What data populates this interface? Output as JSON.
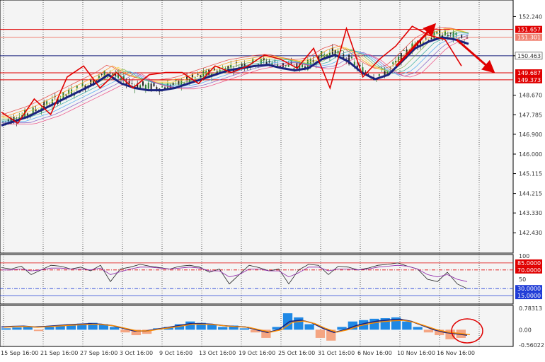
{
  "chart_data": [
    {
      "type": "line",
      "panel": "price",
      "ylim": [
        141.7,
        152.8
      ],
      "y_ticks": [
        "152.240",
        "150.463",
        "148.670",
        "147.785",
        "146.900",
        "146.000",
        "145.115",
        "144.215",
        "143.330",
        "142.430"
      ],
      "horizontal_levels": [
        {
          "label": "151.657",
          "value": 151.657,
          "color": "#e00000",
          "style": "solid",
          "box": true
        },
        {
          "label": "151.301",
          "value": 151.301,
          "color": "#f08070",
          "style": "solid",
          "box": true
        },
        {
          "label": "150.463",
          "value": 150.463,
          "color": "#1a237e",
          "style": "solid",
          "box": false
        },
        {
          "label": "149.687",
          "value": 149.687,
          "color": "#e00000",
          "style": "solid",
          "box": true
        },
        {
          "label": "149.373",
          "value": 149.373,
          "color": "#e00000",
          "style": "solid",
          "box": true
        }
      ],
      "moving_average": [
        147.3,
        147.5,
        147.7,
        148.0,
        148.3,
        148.6,
        148.9,
        149.2,
        149.6,
        149.2,
        149.0,
        148.9,
        148.9,
        149.0,
        149.2,
        149.4,
        149.6,
        149.8,
        149.9,
        150.0,
        150.05,
        149.9,
        149.8,
        149.9,
        150.3,
        150.5,
        150.2,
        149.7,
        149.4,
        149.6,
        150.2,
        150.8,
        151.1,
        151.3,
        151.2,
        151.0
      ],
      "zigzag": [
        147.9,
        147.4,
        148.5,
        147.8,
        149.5,
        150.0,
        149.0,
        149.7,
        149.0,
        149.6,
        149.7,
        149.7,
        149.2,
        150.0,
        149.7,
        150.0,
        150.5,
        150.3,
        149.9,
        150.8,
        149.0,
        151.7,
        149.5,
        150.3,
        150.9,
        151.8,
        151.4,
        151.2,
        150.0
      ],
      "forecast_arrows": [
        {
          "from": 150.0,
          "to": 151.8,
          "direction": "up"
        },
        {
          "from": 151.2,
          "to": 149.8,
          "direction": "down"
        }
      ],
      "x_labels": [
        "15 Sep 16:00",
        "21 Sep 16:00",
        "27 Sep 16:00",
        "3 Oct 16:00",
        "9 Oct 16:00",
        "13 Oct 16:00",
        "19 Oct 16:00",
        "25 Oct 16:00",
        "31 Oct 16:00",
        "6 Nov 16:00",
        "10 Nov 16:00",
        "16 Nov 16:00"
      ]
    },
    {
      "type": "line",
      "panel": "oscillator",
      "ylim": [
        0,
        100
      ],
      "y_ticks": [
        "100",
        "50"
      ],
      "levels": [
        {
          "label": "85.0000",
          "value": 85,
          "color": "#e00000",
          "box": true
        },
        {
          "label": "70.0000",
          "value": 70,
          "color": "#e00000",
          "box": true
        },
        {
          "label": "30.0000",
          "value": 30,
          "color": "#1f3bd6",
          "box": true
        },
        {
          "label": "15.0000",
          "value": 15,
          "color": "#1f3bd6",
          "box": true
        }
      ],
      "series": [
        {
          "values": [
            75,
            72,
            78,
            60,
            70,
            80,
            78,
            72,
            76,
            68,
            80,
            45,
            72,
            76,
            82,
            78,
            75,
            72,
            78,
            80,
            76,
            65,
            72,
            40,
            60,
            80,
            75,
            68,
            72,
            40,
            70,
            82,
            80,
            60,
            78,
            76,
            70,
            74,
            80,
            82,
            85,
            78,
            72,
            50,
            45,
            65,
            40,
            30
          ]
        },
        {
          "values": [
            70,
            70,
            72,
            68,
            70,
            74,
            74,
            72,
            72,
            70,
            74,
            60,
            66,
            72,
            76,
            76,
            74,
            72,
            74,
            76,
            74,
            68,
            68,
            55,
            60,
            72,
            72,
            68,
            68,
            55,
            64,
            76,
            76,
            68,
            72,
            72,
            70,
            72,
            76,
            78,
            80,
            78,
            72,
            60,
            55,
            60,
            50,
            45
          ]
        }
      ]
    },
    {
      "type": "bar",
      "panel": "macd",
      "ylim": [
        -0.56022,
        0.78313
      ],
      "y_ticks": [
        "0.78313",
        "0.00",
        "-0.56022"
      ],
      "histogram": [
        0.05,
        0.08,
        0.1,
        -0.05,
        0.1,
        0.15,
        0.2,
        0.22,
        0.25,
        0.2,
        0.1,
        -0.1,
        -0.2,
        -0.15,
        0.05,
        0.1,
        0.2,
        0.3,
        0.25,
        0.2,
        0.1,
        0.15,
        0.05,
        -0.1,
        -0.3,
        0.1,
        0.6,
        0.45,
        0.2,
        -0.3,
        -0.4,
        0.1,
        0.3,
        0.35,
        0.4,
        0.42,
        0.45,
        0.3,
        0.1,
        -0.1,
        -0.2,
        -0.35,
        -0.3
      ],
      "signal_line": [
        0.1,
        0.12,
        0.13,
        0.1,
        0.12,
        0.15,
        0.18,
        0.2,
        0.22,
        0.2,
        0.15,
        0.05,
        -0.05,
        -0.05,
        0.02,
        0.08,
        0.15,
        0.22,
        0.22,
        0.2,
        0.15,
        0.12,
        0.1,
        0.0,
        -0.1,
        0.0,
        0.3,
        0.35,
        0.25,
        0.05,
        -0.1,
        0.0,
        0.15,
        0.25,
        0.32,
        0.36,
        0.38,
        0.3,
        0.15,
        0.0,
        -0.1,
        -0.15,
        -0.2
      ]
    }
  ]
}
